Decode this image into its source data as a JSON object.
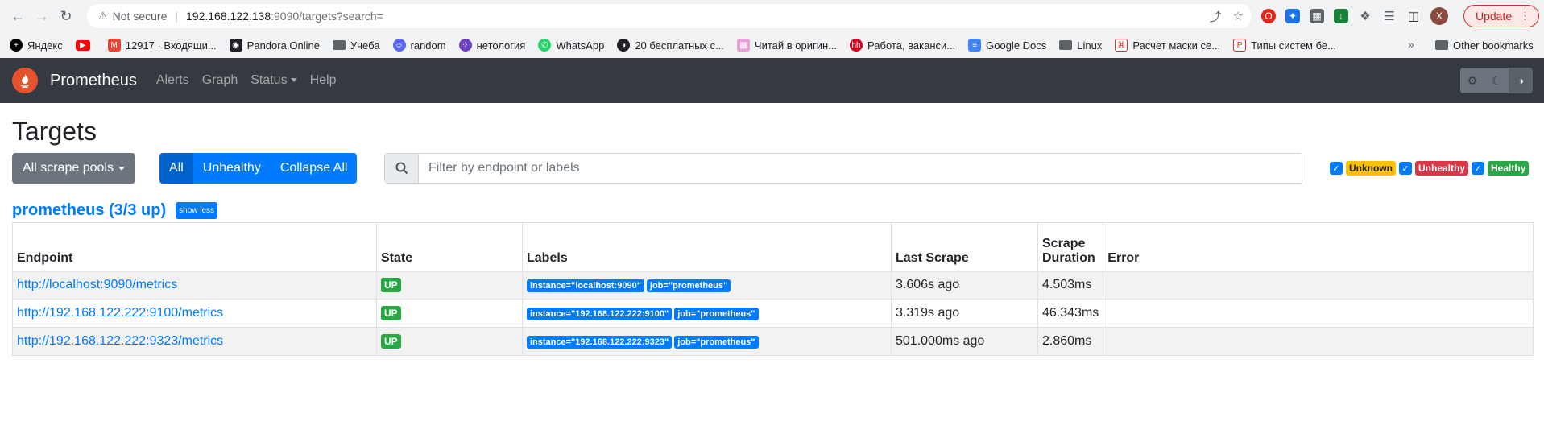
{
  "browser": {
    "not_secure": "Not secure",
    "url_host": "192.168.122.138",
    "url_path": ":9090/targets?search=",
    "update_label": "Update",
    "profile_initial": "X",
    "bookmarks": [
      {
        "label": "Яндекс",
        "icon": "yandex-icon",
        "color": "#000000"
      },
      {
        "label": "",
        "icon": "youtube-icon",
        "color": "#ff0000"
      },
      {
        "label": "12917 · Входящи...",
        "icon": "mail-icon",
        "color": "#ea4335"
      },
      {
        "label": "Pandora Online",
        "icon": "lock-icon",
        "color": "#202124"
      },
      {
        "label": "Учеба",
        "icon": "folder-icon",
        "color": "#5f6368"
      },
      {
        "label": "random",
        "icon": "discord-icon",
        "color": "#5865f2"
      },
      {
        "label": "нетология",
        "icon": "netology-icon",
        "color": "#6f42c1"
      },
      {
        "label": "WhatsApp",
        "icon": "whatsapp-icon",
        "color": "#25d366"
      },
      {
        "label": "20 бесплатных с...",
        "icon": "globe-icon",
        "color": "#202124"
      },
      {
        "label": "Читай в оригин...",
        "icon": "books-icon",
        "color": "#e8a0d8"
      },
      {
        "label": "Работа, ваканси...",
        "icon": "hh-icon",
        "color": "#d6001c"
      },
      {
        "label": "Google Docs",
        "icon": "docs-icon",
        "color": "#4285f4"
      },
      {
        "label": "Linux",
        "icon": "folder-icon",
        "color": "#5f6368"
      },
      {
        "label": "Расчет маски се...",
        "icon": "mask-calc-icon",
        "color": "#d93025"
      },
      {
        "label": "Типы систем бе...",
        "icon": "pdf-icon",
        "color": "#d93025"
      }
    ],
    "other_bookmarks": "Other bookmarks"
  },
  "navbar": {
    "brand": "Prometheus",
    "links": [
      "Alerts",
      "Graph",
      "Status",
      "Help"
    ]
  },
  "page": {
    "title": "Targets",
    "scrape_pools_label": "All scrape pools",
    "buttons": [
      "All",
      "Unhealthy",
      "Collapse All"
    ],
    "search_placeholder": "Filter by endpoint or labels",
    "filters": [
      "Unknown",
      "Unhealthy",
      "Healthy"
    ],
    "pool_title": "prometheus (3/3 up)",
    "show_less": "show less"
  },
  "table": {
    "headers": [
      "Endpoint",
      "State",
      "Labels",
      "Last Scrape",
      "Scrape Duration",
      "Error"
    ],
    "rows": [
      {
        "endpoint": "http://localhost:9090/metrics",
        "state": "UP",
        "labels": [
          "instance=\"localhost:9090\"",
          "job=\"prometheus\""
        ],
        "last_scrape": "3.606s ago",
        "duration": "4.503ms",
        "error": ""
      },
      {
        "endpoint": "http://192.168.122.222:9100/metrics",
        "state": "UP",
        "labels": [
          "instance=\"192.168.122.222:9100\"",
          "job=\"prometheus\""
        ],
        "last_scrape": "3.319s ago",
        "duration": "46.343ms",
        "error": ""
      },
      {
        "endpoint": "http://192.168.122.222:9323/metrics",
        "state": "UP",
        "labels": [
          "instance=\"192.168.122.222:9323\"",
          "job=\"prometheus\""
        ],
        "last_scrape": "501.000ms ago",
        "duration": "2.860ms",
        "error": ""
      }
    ]
  }
}
